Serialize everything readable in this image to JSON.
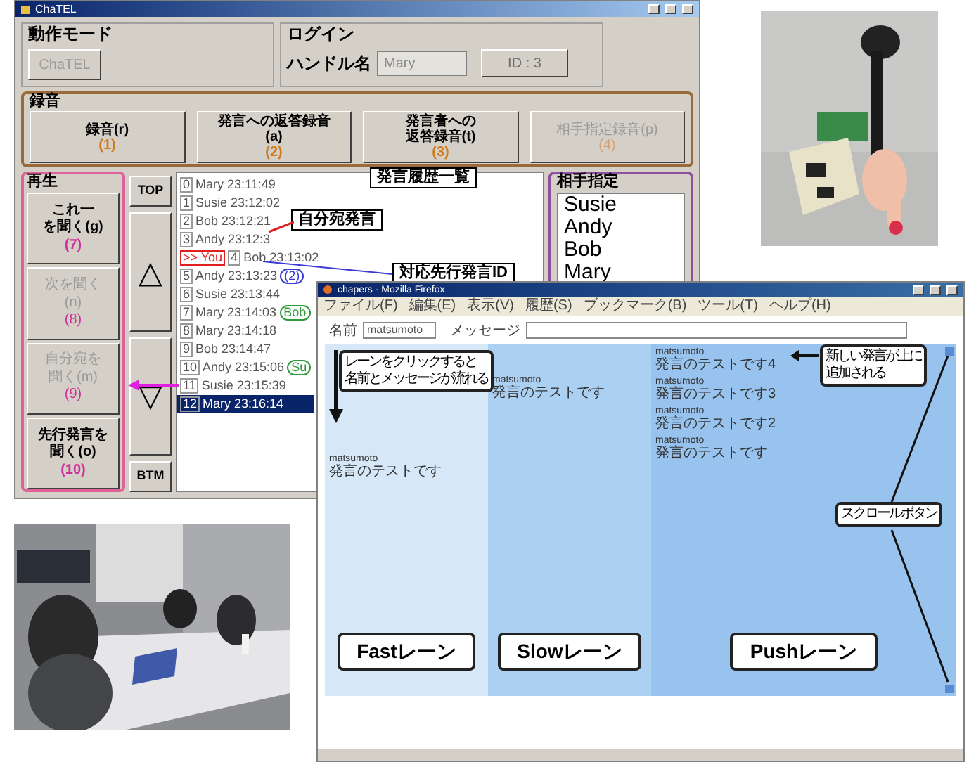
{
  "chatel_window": {
    "title": "ChaTEL",
    "mode_group": {
      "label": "動作モード",
      "button": {
        "label": "ChaTEL",
        "disabled": true
      }
    },
    "login_group": {
      "label": "ログイン",
      "handle_label": "ハンドル名",
      "handle_value": "Mary",
      "id_button": "ID : 3"
    },
    "record_group": {
      "label": "録音",
      "buttons": [
        {
          "lines": [
            "録音(r)"
          ],
          "number": "(1)",
          "disabled": false
        },
        {
          "lines": [
            "発言への返答録音",
            "(a)"
          ],
          "number": "(2)",
          "disabled": false
        },
        {
          "lines": [
            "発言者への",
            "返答録音(t)"
          ],
          "number": "(3)",
          "disabled": false
        },
        {
          "lines": [
            "相手指定録音(p)"
          ],
          "number": "(4)",
          "disabled": true
        }
      ]
    },
    "play_group": {
      "label": "再生",
      "buttons": [
        {
          "lines": [
            "これ一",
            "を聞く(g)"
          ],
          "number": "(7)",
          "disabled": false
        },
        {
          "lines": [
            "次を聞く",
            "(n)"
          ],
          "number": "(8)",
          "disabled": true
        },
        {
          "lines": [
            "自分宛を",
            "聞く(m)"
          ],
          "number": "(9)",
          "disabled": true
        },
        {
          "lines": [
            "先行発言を",
            "聞く(o)"
          ],
          "number": "(10)",
          "disabled": false
        }
      ]
    },
    "nav_buttons": [
      "TOP",
      "△",
      "▽",
      "BTM"
    ],
    "history": [
      {
        "index": "0",
        "text": "Mary 23:11:49",
        "selected": false
      },
      {
        "index": "1",
        "text": "Susie 23:12:02",
        "selected": false
      },
      {
        "index": "2",
        "text": "Bob 23:12:21",
        "selected": false
      },
      {
        "index": "3",
        "text": "Andy 23:12:3",
        "selected": false
      },
      {
        "marker": ">> You",
        "index": "4",
        "text": "Bob 23:13:02",
        "selected": false
      },
      {
        "index": "5",
        "text": "Andy 23:13:23",
        "selected": false,
        "tag": {
          "text": "(2)",
          "color": "#3a3ad8"
        }
      },
      {
        "index": "6",
        "text": "Susie 23:13:44",
        "selected": false
      },
      {
        "index": "7",
        "text": "Mary 23:14:03",
        "selected": false,
        "tag": {
          "text": "Bob",
          "color": "#2f9a3a"
        }
      },
      {
        "index": "8",
        "text": "Mary 23:14:18",
        "selected": false
      },
      {
        "index": "9",
        "text": "Bob 23:14:47",
        "selected": false
      },
      {
        "index": "10",
        "text": "Andy 23:15:06",
        "selected": false,
        "tag": {
          "text": "Su",
          "color": "#2f9a3a"
        }
      },
      {
        "index": "11",
        "text": "Susie 23:15:39",
        "selected": false
      },
      {
        "index": "12",
        "text": "Mary 23:16:14",
        "selected": true
      }
    ],
    "partner_group": {
      "label": "相手指定",
      "items": [
        "Susie",
        "Andy",
        "Bob",
        "Mary"
      ]
    },
    "annotations": [
      "発言履歴一覧",
      "自分宛発言",
      "対応先行発言ID"
    ]
  },
  "browser_window": {
    "title": "chapers - Mozilla Firefox",
    "menu": [
      "ファイル(F)",
      "編集(E)",
      "表示(V)",
      "履歴(S)",
      "ブックマーク(B)",
      "ツール(T)",
      "ヘルプ(H)"
    ],
    "name_label": "名前",
    "name_value": "matsumoto",
    "message_label": "メッセージ",
    "lanes": [
      {
        "label": "Fastレーン",
        "color": "#d6e8f8",
        "messages": [
          {
            "name": "matsumoto",
            "text": "発言のテストです"
          }
        ]
      },
      {
        "label": "Slowレーン",
        "color": "#acd0f2",
        "messages": [
          {
            "name": "matsumoto",
            "text": "発言のテストです"
          }
        ]
      },
      {
        "label": "Pushレーン",
        "color": "#97c3ee",
        "messages": [
          {
            "name": "matsumoto",
            "text": "発言のテストです4"
          },
          {
            "name": "matsumoto",
            "text": "発言のテストです3"
          },
          {
            "name": "matsumoto",
            "text": "発言のテストです2"
          },
          {
            "name": "matsumoto",
            "text": "発言のテストです"
          }
        ]
      }
    ],
    "annotations": [
      {
        "lines": [
          "レーンをクリックすると",
          "名前とメッセージが流れる"
        ]
      },
      {
        "lines": [
          "新しい発言が上に",
          "追加される"
        ]
      },
      {
        "lines": [
          "スクロールボタン"
        ]
      }
    ]
  }
}
